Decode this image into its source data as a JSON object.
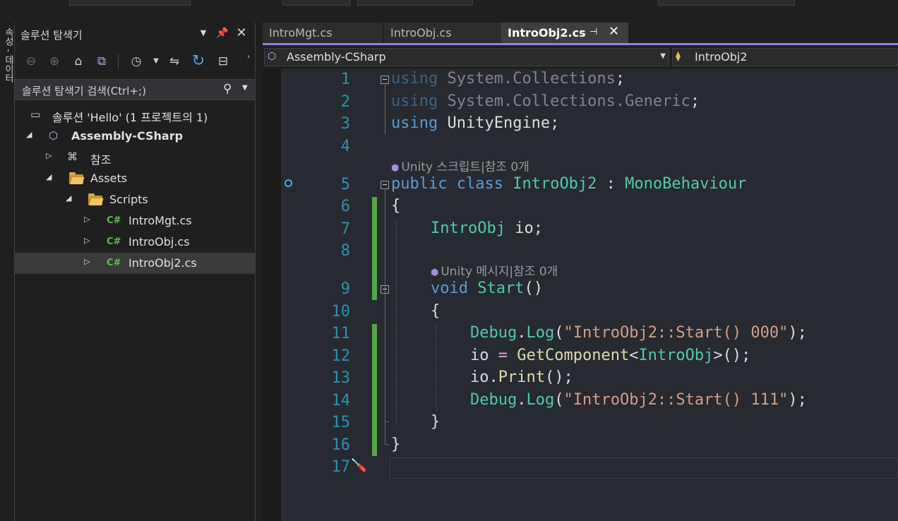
{
  "solution_explorer": {
    "sidebar_label": "속성 - 데이터",
    "title": "솔루션 탐색기",
    "search_placeholder": "솔루션 탐색기 검색(Ctrl+;)",
    "tree": {
      "solution": "솔루션 'Hello' (1 프로젝트의 1)",
      "project": "Assembly-CSharp",
      "references": "참조",
      "assets": "Assets",
      "scripts": "Scripts",
      "files": [
        "IntroMgt.cs",
        "IntroObj.cs",
        "IntroObj2.cs"
      ],
      "selected_file": "IntroObj2.cs"
    },
    "cs_badge": "C#"
  },
  "editor": {
    "tabs": [
      {
        "label": "IntroMgt.cs",
        "active": false
      },
      {
        "label": "IntroObj.cs",
        "active": false
      },
      {
        "label": "IntroObj2.cs",
        "active": true
      }
    ],
    "nav": {
      "project": "Assembly-CSharp",
      "type": "IntroObj2"
    },
    "codelens": {
      "class_lens": "Unity 스크립트|참조 0개",
      "method_lens": "Unity 메시지|참조 0개"
    },
    "line_numbers": [
      "1",
      "2",
      "3",
      "4",
      "5",
      "6",
      "7",
      "8",
      "9",
      "10",
      "11",
      "12",
      "13",
      "14",
      "15",
      "16",
      "17"
    ],
    "code": {
      "l1": {
        "kw": "using",
        "ns": " System",
        "dot": ".",
        "rest": "Collections",
        "end": ";"
      },
      "l2": {
        "kw": "using",
        "ns": " System",
        "dot": ".",
        "mid": "Collections",
        "dot2": ".",
        "rest": "Generic",
        "end": ";"
      },
      "l3": {
        "kw": "using",
        "rest": " UnityEngine;"
      },
      "l5": {
        "kw1": "public",
        "kw2": " class",
        "name": " IntroObj2",
        "colon": " :",
        "base": " MonoBehaviour"
      },
      "l6": "{",
      "l7": {
        "type": "IntroObj",
        "rest": " io;"
      },
      "l9": {
        "kw": "void",
        "name": " Start",
        "rest": "()"
      },
      "l10": "{",
      "l11": {
        "obj": "Debug",
        "dot": ".",
        "fn": "Log",
        "open": "(",
        "str": "\"IntroObj2::Start() 000\"",
        "close": ");"
      },
      "l12": {
        "a": "io",
        "eq": " =",
        "fn": " GetComponent",
        "lt": "<",
        "type": "IntroObj",
        "gt": ">",
        "close": "();"
      },
      "l13": {
        "a": "io",
        "dot": ".",
        "fn": "Print",
        "close": "();"
      },
      "l14": {
        "obj": "Debug",
        "dot": ".",
        "fn": "Log",
        "open": "(",
        "str": "\"IntroObj2::Start() 111\"",
        "close": ");"
      },
      "l15": "}",
      "l16": "}"
    }
  },
  "colors": {
    "keyword": "#569cd6",
    "type": "#4ec9b0",
    "string": "#d69d85",
    "line_number": "#2b91af",
    "change_bar": "#57a64a",
    "tab_accent": "#9a7ee8"
  }
}
